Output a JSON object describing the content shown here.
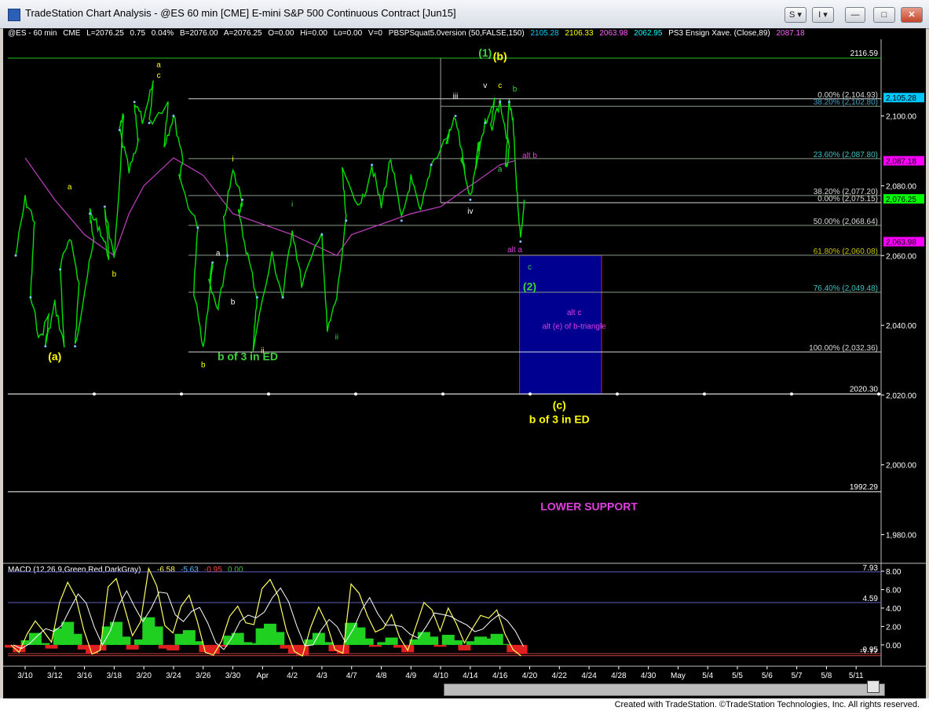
{
  "window": {
    "title": "TradeStation Chart Analysis - @ES 60 min [CME] E-mini S&P 500 Continuous Contract [Jun15]",
    "btn_s": "S ▾",
    "btn_i": "I ▾"
  },
  "infobar": {
    "symbol": "@ES - 60 min",
    "exchange": "CME",
    "last": "L=2076.25",
    "change": "0.75",
    "pct": "0.04%",
    "bid": "B=2076.00",
    "ask": "A=2076.25",
    "chg": "O=0.00",
    "hi": "Hi=0.00",
    "lo": "Lo=0.00",
    "vol": "V=0",
    "indicator": "PBSPSquat5.0version (50,FALSE,150)",
    "iv1": "2105.28",
    "iv2": "2106.33",
    "iv3": "2063.98",
    "iv4": "2062.95",
    "ma_label": "PS3 Ensign Xave. (Close,89)",
    "ma_value": "2087.18"
  },
  "footer": {
    "credit": "Created with TradeStation. ©TradeStation Technologies, Inc. All rights reserved."
  },
  "colors": {
    "price": "#00e000",
    "ma": "#c040c0",
    "fib": "#c8c8c8",
    "box": "#000090",
    "wave_yellow": "#ffff00",
    "wave_green": "#40d040",
    "magenta": "#e040e0"
  },
  "chart_data": [
    {
      "type": "line",
      "title": "@ES 60 min [CME] E-mini S&P 500 Continuous Contract [Jun15]",
      "ylim": [
        1972,
        2122
      ],
      "y_ticks": [
        1980,
        2000,
        2020,
        2040,
        2060,
        2080,
        2100
      ],
      "y_tick_labels": [
        "1,980.00",
        "2,000.00",
        "2,020.00",
        "2,040.00",
        "2,060.00",
        "2,080.00",
        "2,100.00"
      ],
      "x_tick_labels": [
        "3/10",
        "3/12",
        "3/16",
        "3/18",
        "3/20",
        "3/24",
        "3/26",
        "3/30",
        "Apr",
        "4/2",
        "4/3",
        "4/7",
        "4/8",
        "4/9",
        "4/10",
        "4/14",
        "4/16",
        "4/20",
        "4/22",
        "4/24",
        "4/28",
        "4/30",
        "May",
        "5/4",
        "5/5",
        "5/6",
        "5/7",
        "5/8",
        "5/11"
      ],
      "series": [
        {
          "name": "@ES",
          "points": [
            [
              "3/10",
              2060
            ],
            [
              "3/10",
              2076
            ],
            [
              "3/10",
              2070
            ],
            [
              "3/11",
              2048
            ],
            [
              "3/11",
              2036
            ],
            [
              "3/11",
              2044
            ],
            [
              "3/12",
              2034
            ],
            [
              "3/12",
              2046
            ],
            [
              "3/12",
              2034
            ],
            [
              "3/13",
              2056
            ],
            [
              "3/13",
              2066
            ],
            [
              "3/13",
              2052
            ],
            [
              "3/16",
              2034
            ],
            [
              "3/16",
              2050
            ],
            [
              "3/16",
              2064
            ],
            [
              "3/17",
              2072
            ],
            [
              "3/17",
              2068
            ],
            [
              "3/17",
              2060
            ],
            [
              "3/18",
              2074
            ],
            [
              "3/18",
              2058
            ],
            [
              "3/18",
              2100
            ],
            [
              "3/19",
              2096
            ],
            [
              "3/19",
              2084
            ],
            [
              "3/19",
              2092
            ],
            [
              "3/20",
              2104
            ],
            [
              "3/20",
              2098
            ],
            [
              "3/20",
              2110
            ],
            [
              "3/23",
              2098
            ],
            [
              "3/23",
              2104
            ],
            [
              "3/24",
              2092
            ],
            [
              "3/24",
              2100
            ],
            [
              "3/24",
              2088
            ],
            [
              "3/25",
              2082
            ],
            [
              "3/25",
              2068
            ],
            [
              "3/26",
              2050
            ],
            [
              "3/26",
              2033
            ],
            [
              "3/26",
              2058
            ],
            [
              "3/27",
              2052
            ],
            [
              "3/27",
              2044
            ],
            [
              "3/27",
              2060
            ],
            [
              "3/30",
              2070
            ],
            [
              "3/30",
              2084
            ],
            [
              "3/30",
              2076
            ],
            [
              "3/31",
              2072
            ],
            [
              "3/31",
              2060
            ],
            [
              "3/31",
              2048
            ],
            [
              "Apr",
              2034
            ],
            [
              "Apr",
              2060
            ],
            [
              "4/2",
              2048
            ],
            [
              "4/2",
              2068
            ],
            [
              "4/2",
              2052
            ],
            [
              "4/3",
              2066
            ],
            [
              "4/6",
              2038
            ],
            [
              "4/6",
              2048
            ],
            [
              "4/6",
              2070
            ],
            [
              "4/7",
              2084
            ],
            [
              "4/7",
              2074
            ],
            [
              "4/8",
              2086
            ],
            [
              "4/8",
              2074
            ],
            [
              "4/8",
              2088
            ],
            [
              "4/9",
              2070
            ],
            [
              "4/9",
              2082
            ],
            [
              "4/9",
              2072
            ],
            [
              "4/10",
              2086
            ],
            [
              "4/10",
              2096
            ],
            [
              "4/13",
              2092
            ],
            [
              "4/13",
              2100
            ],
            [
              "4/13",
              2084
            ],
            [
              "4/14",
              2088
            ],
            [
              "4/14",
              2076
            ],
            [
              "4/14",
              2094
            ],
            [
              "4/15",
              2086
            ],
            [
              "4/15",
              2098
            ],
            [
              "4/15",
              2104
            ],
            [
              "4/16",
              2096
            ],
            [
              "4/16",
              2104
            ],
            [
              "4/16",
              2090
            ],
            [
              "4/17",
              2084
            ],
            [
              "4/17",
              2104
            ],
            [
              "4/17",
              2098
            ],
            [
              "4/17",
              2080
            ],
            [
              "4/17",
              2064
            ],
            [
              "4/17",
              2076
            ]
          ]
        },
        {
          "name": "PS3 Ensign Xave. (Close,89)",
          "points": [
            [
              "3/10",
              2088
            ],
            [
              "3/12",
              2076
            ],
            [
              "3/16",
              2066
            ],
            [
              "3/18",
              2060
            ],
            [
              "3/19",
              2072
            ],
            [
              "3/20",
              2080
            ],
            [
              "3/24",
              2088
            ],
            [
              "3/26",
              2083
            ],
            [
              "3/30",
              2072
            ],
            [
              "4/2",
              2066
            ],
            [
              "4/6",
              2060
            ],
            [
              "4/7",
              2066
            ],
            [
              "4/9",
              2072
            ],
            [
              "4/10",
              2074
            ],
            [
              "4/14",
              2080
            ],
            [
              "4/16",
              2086
            ],
            [
              "4/17",
              2087.18
            ]
          ]
        }
      ],
      "fib_levels": [
        {
          "label": "0.00% (2,104.93)",
          "value": 2104.93
        },
        {
          "label": "38.20% (2,102.80)",
          "value": 2102.8
        },
        {
          "label": "23.60% (2,087.80)",
          "value": 2087.8
        },
        {
          "label": "38.20% (2,077.20)",
          "value": 2077.2
        },
        {
          "label": "0.00% (2,075.15)",
          "value": 2075.15
        },
        {
          "label": "50.00% (2,068.64)",
          "value": 2068.64
        },
        {
          "label": "61.80% (2,060.08)",
          "value": 2060.08
        },
        {
          "label": "76.40% (2,049.48)",
          "value": 2049.48
        },
        {
          "label": "100.00% (2,032.36)",
          "value": 2032.36
        }
      ],
      "hlines": [
        {
          "label": "2116.59",
          "value": 2116.59
        },
        {
          "label": "2020.30",
          "value": 2020.3
        },
        {
          "label": "1992.29",
          "value": 1992.29
        }
      ],
      "price_tags": [
        {
          "label": "2,105.28",
          "value": 2105.28,
          "color": "#00c8ff"
        },
        {
          "label": "2,087.18",
          "value": 2087.18,
          "color": "#ff00ff"
        },
        {
          "label": "2,076.25",
          "value": 2076.25,
          "color": "#00ff00"
        },
        {
          "label": "2,063.98",
          "value": 2063.98,
          "color": "#ff00ff"
        }
      ],
      "target_box": {
        "x_start": "4/17",
        "x_end": "4/24",
        "y_low": 2020.3,
        "y_high": 2060.08
      },
      "annotations": [
        {
          "text": "(a)",
          "x": "3/12",
          "y": 2030,
          "color": "yellow"
        },
        {
          "text": "a",
          "x": "3/13",
          "y": 2079,
          "color": "yellow"
        },
        {
          "text": "b",
          "x": "3/18",
          "y": 2054,
          "color": "yellow"
        },
        {
          "text": "a",
          "x": "3/23",
          "y": 2114,
          "color": "yellow"
        },
        {
          "text": "c",
          "x": "3/23",
          "y": 2111,
          "color": "yellow"
        },
        {
          "text": "b",
          "x": "3/26",
          "y": 2028,
          "color": "yellow"
        },
        {
          "text": "a",
          "x": "3/27",
          "y": 2060,
          "color": "white"
        },
        {
          "text": "b",
          "x": "3/30",
          "y": 2046,
          "color": "white"
        },
        {
          "text": "b of 3 in ED",
          "x": "3/31",
          "y": 2030,
          "color": "green"
        },
        {
          "text": "i",
          "x": "3/30",
          "y": 2087,
          "color": "yellow"
        },
        {
          "text": "ii",
          "x": "Apr",
          "y": 2032,
          "color": "yellow"
        },
        {
          "text": "i",
          "x": "4/2",
          "y": 2074,
          "color": "green"
        },
        {
          "text": "ii",
          "x": "4/6",
          "y": 2036,
          "color": "green"
        },
        {
          "text": "iii",
          "x": "4/13",
          "y": 2105,
          "color": "white"
        },
        {
          "text": "iv",
          "x": "4/14",
          "y": 2072,
          "color": "white"
        },
        {
          "text": "(1)",
          "x": "4/15",
          "y": 2117,
          "color": "green"
        },
        {
          "text": "v",
          "x": "4/15",
          "y": 2108,
          "color": "white"
        },
        {
          "text": "(b)",
          "x": "4/16",
          "y": 2116,
          "color": "yellow"
        },
        {
          "text": "c",
          "x": "4/16",
          "y": 2108,
          "color": "yellow"
        },
        {
          "text": "b",
          "x": "4/17",
          "y": 2107,
          "color": "green"
        },
        {
          "text": "a",
          "x": "4/16",
          "y": 2084,
          "color": "green"
        },
        {
          "text": "alt b",
          "x": "4/20",
          "y": 2088,
          "color": "magenta"
        },
        {
          "text": "alt a",
          "x": "4/17",
          "y": 2061,
          "color": "magenta"
        },
        {
          "text": "c",
          "x": "4/20",
          "y": 2056,
          "color": "green"
        },
        {
          "text": "(2)",
          "x": "4/20",
          "y": 2050,
          "color": "green"
        },
        {
          "text": "alt c",
          "x": "4/23",
          "y": 2043,
          "color": "magenta"
        },
        {
          "text": "alt (e) of b-triangle",
          "x": "4/23",
          "y": 2039,
          "color": "magenta"
        },
        {
          "text": "(c)",
          "x": "4/22",
          "y": 2016,
          "color": "yellow"
        },
        {
          "text": "b of 3 in ED",
          "x": "4/22",
          "y": 2012,
          "color": "yellow"
        },
        {
          "text": "LOWER SUPPORT",
          "x": "4/24",
          "y": 1987,
          "color": "magenta"
        }
      ]
    },
    {
      "type": "area",
      "title": "MACD (12,26,9,Green,Red,DarkGray)",
      "legend_values": [
        "-6.58",
        "-5.63",
        "-0.95",
        "0.00"
      ],
      "legend_colors": [
        "#ffff60",
        "#60c0ff",
        "#ff4040",
        "#40c040"
      ],
      "ylim": [
        -1.8,
        8.6
      ],
      "y_ticks": [
        0,
        2,
        4,
        6,
        8
      ],
      "y_tick_labels": [
        "0.00",
        "2.00",
        "4.00",
        "6.00",
        "8.00"
      ],
      "hlines": [
        {
          "label": "7.93",
          "value": 7.93
        },
        {
          "label": "4.59",
          "value": 4.59
        },
        {
          "label": "-1.17",
          "value": -1.17
        },
        {
          "label": "-0.95",
          "value": -0.95
        }
      ],
      "macd": [
        0,
        -0.8,
        1.2,
        2.6,
        1.5,
        0.3,
        4.6,
        6.8,
        5.2,
        1.6,
        -1,
        -0.6,
        6.3,
        7.2,
        4.1,
        1,
        2.5,
        8.3,
        6.4,
        2.1,
        1.3,
        4.2,
        5.4,
        2.6,
        -0.8,
        -1.1,
        0.4,
        3.1,
        4.2,
        2.4,
        2.2,
        6.1,
        7.1,
        5.3,
        1.6,
        -0.7,
        -1.2,
        1.9,
        4.1,
        2.3,
        -0.5,
        -0.9,
        6.6,
        5.6,
        3.2,
        1.4,
        1.8,
        3.3,
        0.8,
        -0.6,
        2,
        4.6,
        3.8,
        1.5,
        4,
        2.3,
        0.2,
        1.8,
        3.2,
        2.9,
        3.8,
        1.2,
        -0.5,
        -1.2
      ],
      "histogram": [
        -0.3,
        -0.8,
        0.5,
        1.3,
        0.2,
        -0.4,
        1.8,
        2.5,
        1.2,
        -0.5,
        -1,
        -0.6,
        2,
        2.5,
        0.9,
        -0.5,
        0.6,
        3,
        2,
        -0.4,
        -0.6,
        1.2,
        1.6,
        0.4,
        -0.8,
        -1,
        -0.2,
        1,
        1.3,
        0.3,
        0.2,
        1.8,
        2.3,
        1.4,
        -0.4,
        -0.9,
        -1.1,
        0.6,
        1.3,
        0.3,
        -0.7,
        -1,
        2.4,
        1.9,
        0.7,
        -0.2,
        0.3,
        0.8,
        -0.3,
        -0.8,
        0.6,
        1.4,
        0.9,
        -0.2,
        1.1,
        0.5,
        -0.6,
        0.4,
        0.9,
        0.7,
        1.2,
        0.1,
        -0.8,
        -1
      ]
    }
  ]
}
